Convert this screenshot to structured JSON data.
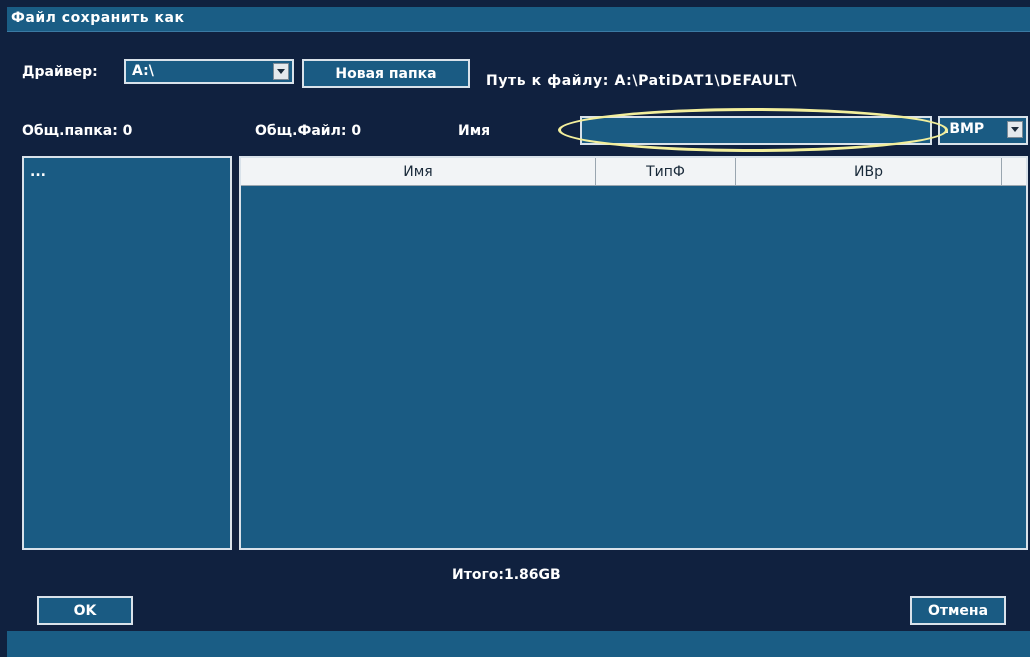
{
  "title": "Файл сохранить как",
  "driver": {
    "label": "Драйвер:",
    "value": "A:\\"
  },
  "new_folder_label": "Новая папка",
  "path": {
    "label": "Путь к файлу:",
    "value": "A:\\PatiDAT1\\DEFAULT\\"
  },
  "counts": {
    "folders": "Общ.папка: 0",
    "files": "Общ.Файл: 0"
  },
  "name": {
    "label": "Имя",
    "value": "",
    "extension": ".BMP"
  },
  "folder_list": {
    "items": [
      "..."
    ]
  },
  "file_table": {
    "columns": [
      "Имя",
      "ТипФ",
      "ИВр"
    ],
    "rows": []
  },
  "total": "Итого:1.86GB",
  "ok_label": "OK",
  "cancel_label": "Отмена",
  "colors": {
    "background": "#10213f",
    "panel": "#1a5b83",
    "highlight": "#f3ef9c"
  }
}
